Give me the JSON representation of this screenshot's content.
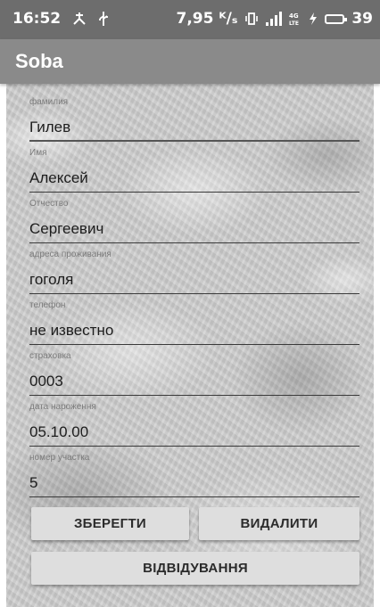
{
  "status_bar": {
    "time": "16:52",
    "speed": "7,95 ᴷ/ₛ",
    "battery": "39",
    "icons": [
      "usb-debug-icon",
      "usb-icon",
      "vibrate-icon",
      "signal-icon",
      "lte-icon",
      "charging-icon",
      "battery-icon"
    ]
  },
  "app_bar": {
    "title": "Soba"
  },
  "form": {
    "fields": [
      {
        "label": "фамилия",
        "value": "Гилев"
      },
      {
        "label": "Имя",
        "value": "Алексей"
      },
      {
        "label": "Отчество",
        "value": "Сергеевич"
      },
      {
        "label": "адреса проживания",
        "value": "гоголя"
      },
      {
        "label": "телефон",
        "value": "не известно"
      },
      {
        "label": "страховка",
        "value": "0003"
      },
      {
        "label": "дата нароження",
        "value": "05.10.00"
      },
      {
        "label": "номер участка",
        "value": "5"
      }
    ]
  },
  "buttons": {
    "save": "ЗБЕРЕГТИ",
    "delete": "ВИДАЛИТИ",
    "visits": "ВІДВІДУВАННЯ"
  },
  "colors": {
    "status_bar": "#6d6d6d",
    "app_bar": "#8a8a8a",
    "button": "#dedede"
  }
}
